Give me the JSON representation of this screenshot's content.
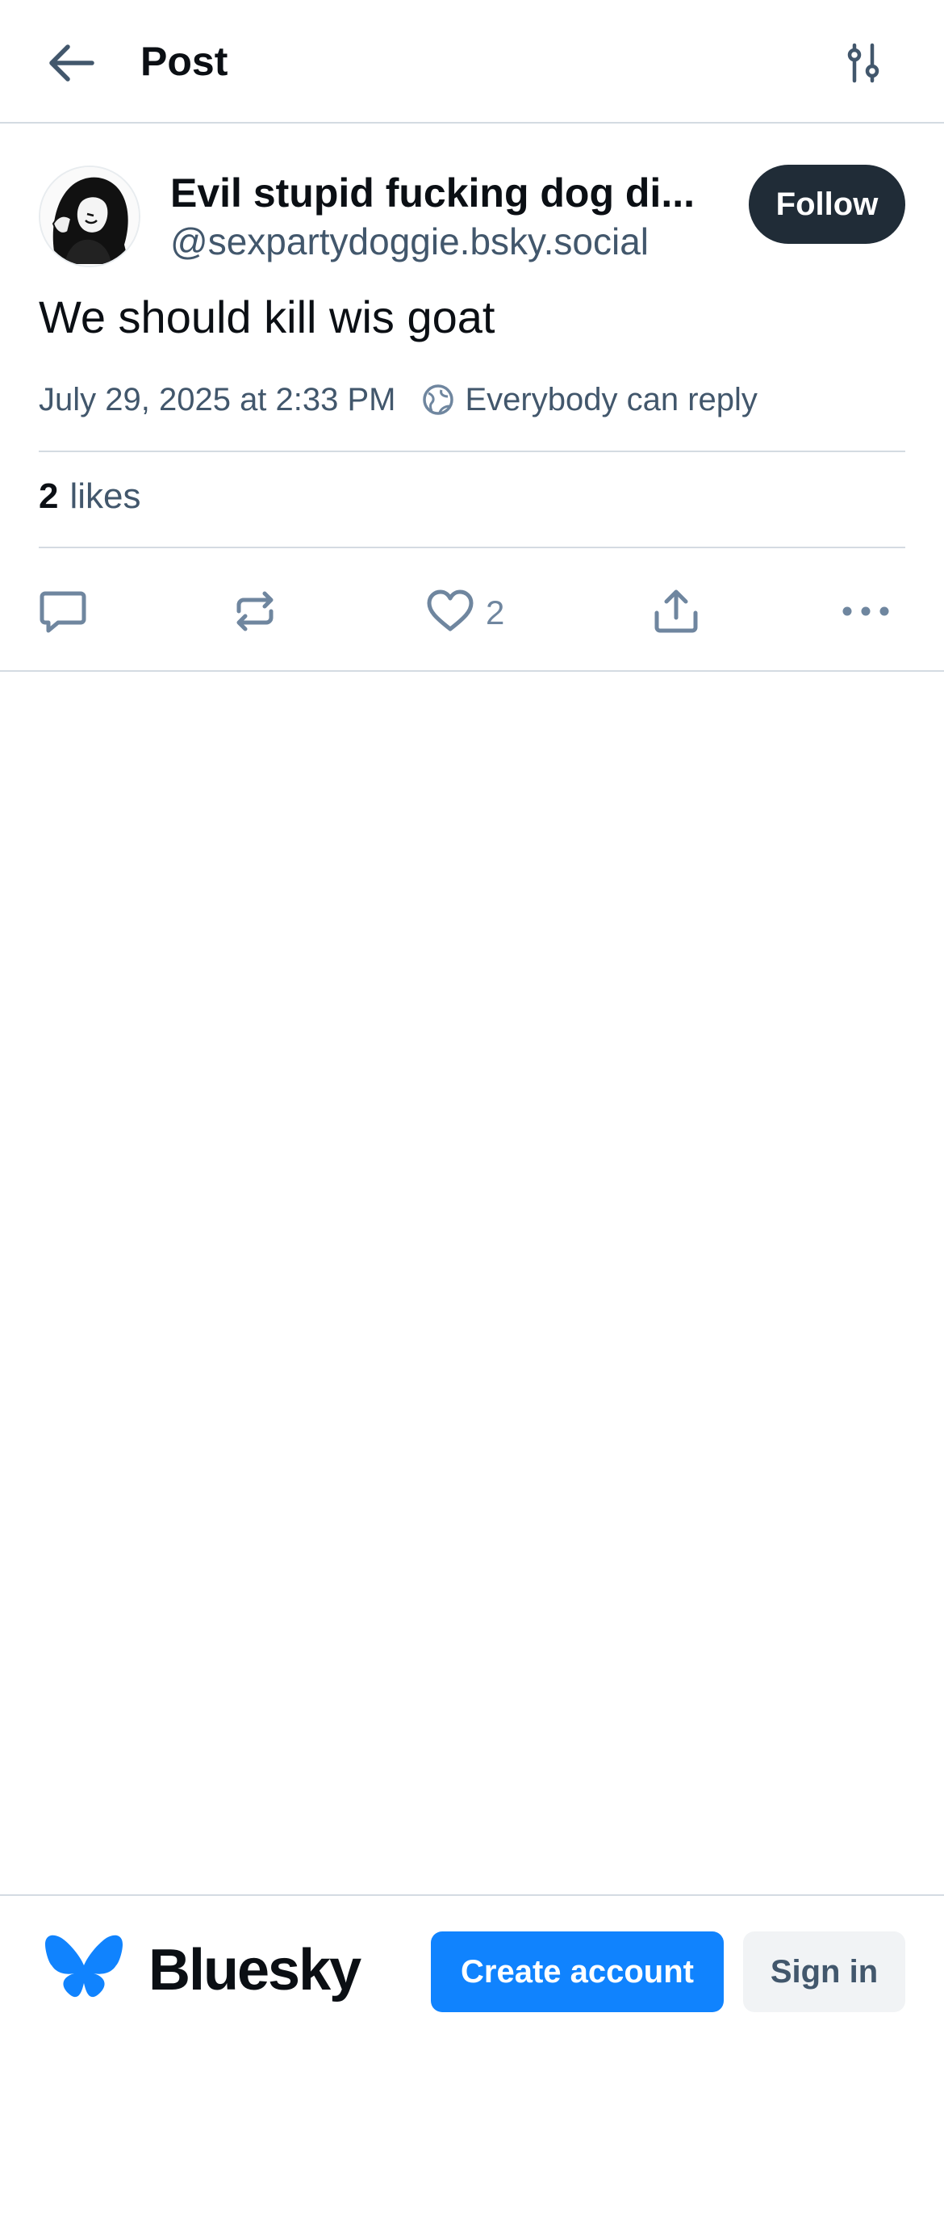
{
  "header": {
    "title": "Post",
    "back_icon": "arrow-left-icon",
    "settings_icon": "sliders-icon"
  },
  "post": {
    "author": {
      "display_name": "Evil stupid fucking dog di...",
      "handle": "@sexpartydoggie.bsky.social"
    },
    "follow_label": "Follow",
    "text": "We should kill wis goat",
    "timestamp": "July 29, 2025 at 2:33 PM",
    "reply_setting": "Everybody can reply",
    "likes_count": "2",
    "likes_label": "likes",
    "actions": {
      "reply_icon": "speech-bubble-icon",
      "repost_icon": "repost-icon",
      "like_icon": "heart-icon",
      "like_count": "2",
      "share_icon": "share-icon",
      "more_icon": "more-dots-icon"
    }
  },
  "footer": {
    "brand_name": "Bluesky",
    "create_account_label": "Create account",
    "sign_in_label": "Sign in"
  },
  "colors": {
    "brand_blue": "#1083fe",
    "follow_bg": "#202c37",
    "muted_text": "#42576c",
    "divider": "#d4dbe2"
  }
}
